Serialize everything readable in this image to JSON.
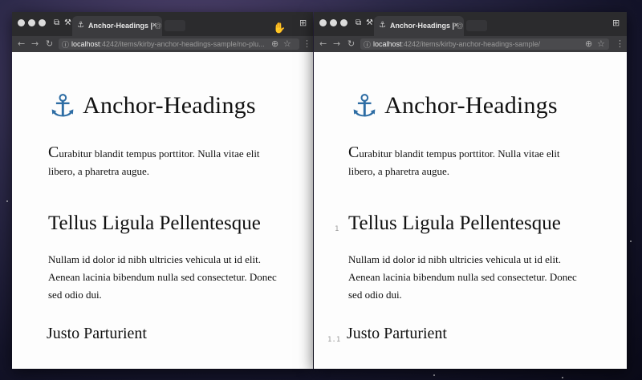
{
  "left": {
    "tab_title": "Anchor-Headings |",
    "tab_faded": "@e",
    "close": "×",
    "url_host": "localhost",
    "url_path": ":4242/items/kirby-anchor-headings-sample/no-plu...",
    "heading": "Anchor-Headings",
    "intro_first": "C",
    "intro_rest": "urabitur blandit tempus porttitor. Nulla vitae elit libero, a pharetra augue.",
    "h2": "Tellus Ligula Pellentesque",
    "para2": "Nullam id dolor id nibh ultricies vehicula ut id elit. Aenean lacinia bibendum nulla sed consectetur. Donec sed odio dui.",
    "h3": "Justo Parturient"
  },
  "right": {
    "tab_title": "Anchor-Headings |",
    "tab_faded": "@e",
    "close": "×",
    "url_host": "localhost",
    "url_path": ":4242/items/kirby-anchor-headings-sample/",
    "heading": "Anchor-Headings",
    "intro_first": "C",
    "intro_rest": "urabitur blandit tempus porttitor. Nulla vitae elit libero, a pharetra augue.",
    "h2_number": "1",
    "h2": "Tellus Ligula Pellentesque",
    "para2": "Nullam id dolor id nibh ultricies vehicula ut id elit. Aenean lacinia bibendum nulla sed consectetur. Donec sed odio dui.",
    "h3_number": "1.1",
    "h3": "Justo Parturient"
  },
  "icons": {
    "anchor": "⚓",
    "back": "←",
    "forward": "→",
    "reload": "↻",
    "info": "ⓘ",
    "zoom": "⊕",
    "star": "☆",
    "menu": "⋮",
    "extension": "⊞"
  },
  "colors": {
    "accent": "#2e6da4",
    "tabbar": "#2b2b2d",
    "chrome": "#3b3b3e"
  }
}
